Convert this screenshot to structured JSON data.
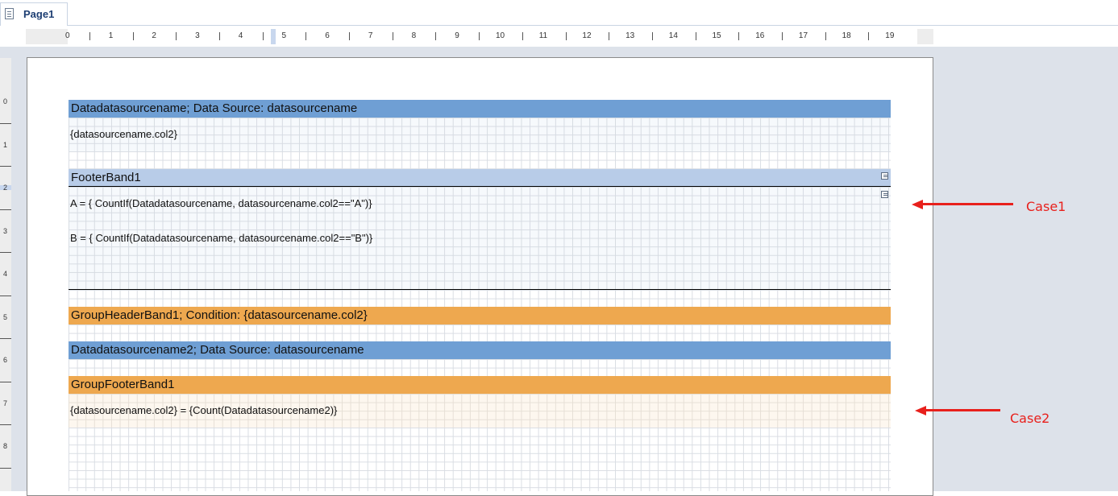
{
  "tab": {
    "label": "Page1",
    "icon": "page-icon"
  },
  "ruler": {
    "h_numbers": [
      "0",
      "1",
      "2",
      "3",
      "4",
      "5",
      "6",
      "7",
      "8",
      "9",
      "10",
      "11",
      "12",
      "13",
      "14",
      "15",
      "16",
      "17",
      "18",
      "19"
    ],
    "v_numbers": [
      "0",
      "1",
      "2",
      "3",
      "4",
      "5",
      "6",
      "7",
      "8"
    ]
  },
  "bands": {
    "data1_header": "Datadatasourcename; Data Source: datasourcename",
    "data1_field": "{datasourcename.col2}",
    "footer_header": "FooterBand1",
    "footer_line_a": "A = { CountIf(Datadatasourcename, datasourcename.col2==\"A\")}",
    "footer_line_b": "B = { CountIf(Datadatasourcename, datasourcename.col2==\"B\")}",
    "group_header": "GroupHeaderBand1; Condition: {datasourcename.col2}",
    "data2_header": "Datadatasourcename2; Data Source: datasourcename",
    "group_footer_header": "GroupFooterBand1",
    "group_footer_text": "{datasourcename.col2} = {Count(Datadatasourcename2)}"
  },
  "annotations": {
    "case1": "Case1",
    "case2": "Case2"
  },
  "colors": {
    "data_band": "#6f9fd4",
    "footer_band": "#b8cce8",
    "group_band": "#eea84f",
    "annotation": "#e8201c"
  }
}
